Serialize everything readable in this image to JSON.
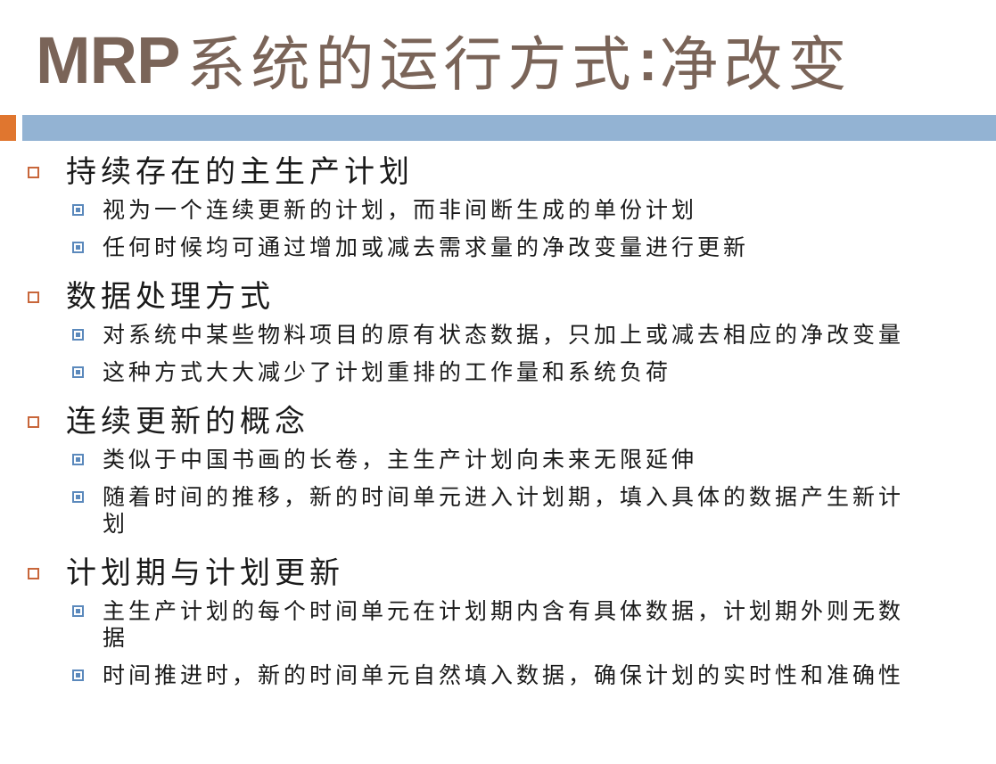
{
  "slide": {
    "title_latin": "MRP",
    "title_cjk": "系统的运行方式",
    "title_sep": ":",
    "title_tail": "净改变",
    "colors": {
      "title": "#7a6458",
      "accent": "#e0762f",
      "bar": "#93b3d3",
      "bullet1": "#c8663a",
      "bullet2": "#5b89bc"
    },
    "sections": [
      {
        "heading": "持续存在的主生产计划",
        "items": [
          "视为一个连续更新的计划，而非间断生成的单份计划",
          "任何时候均可通过增加或减去需求量的净改变量进行更新"
        ]
      },
      {
        "heading": "数据处理方式",
        "items": [
          "对系统中某些物料项目的原有状态数据，只加上或减去相应的净改变量",
          "这种方式大大减少了计划重排的工作量和系统负荷"
        ]
      },
      {
        "heading": "连续更新的概念",
        "items": [
          "类似于中国书画的长卷，主生产计划向未来无限延伸",
          "随着时间的推移，新的时间单元进入计划期，填入具体的数据产生新计划"
        ]
      },
      {
        "heading": "计划期与计划更新",
        "items": [
          "主生产计划的每个时间单元在计划期内含有具体数据，计划期外则无数据",
          "时间推进时，新的时间单元自然填入数据，确保计划的实时性和准确性"
        ]
      }
    ]
  }
}
